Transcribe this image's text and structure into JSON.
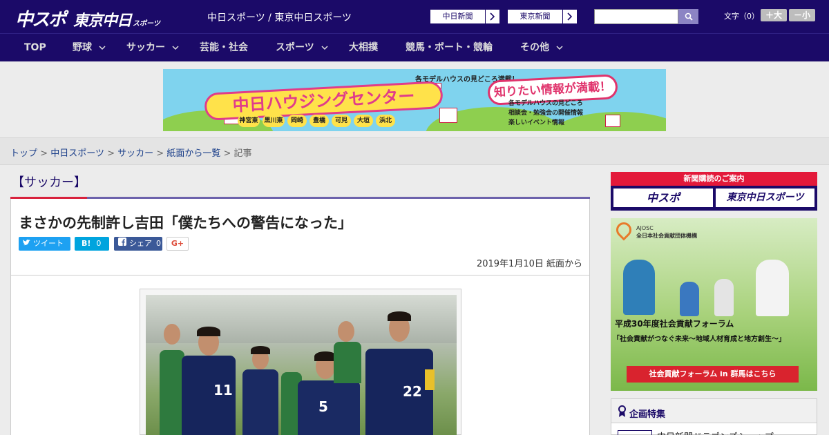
{
  "header": {
    "logo_main": "中スポ",
    "logo_tokyo": "東京中日",
    "logo_sports": "スポーツ",
    "site_description": "中日スポーツ / 東京中日スポーツ",
    "paper_links": [
      "中日新聞",
      "東京新聞"
    ],
    "search_placeholder": "",
    "font_size_label": "文字（0）",
    "font_larger": "＋大",
    "font_smaller": "－小"
  },
  "nav": {
    "items": [
      {
        "label": "TOP",
        "has_dropdown": false
      },
      {
        "label": "野球",
        "has_dropdown": true
      },
      {
        "label": "サッカー",
        "has_dropdown": true
      },
      {
        "label": "芸能・社会",
        "has_dropdown": false
      },
      {
        "label": "スポーツ",
        "has_dropdown": true
      },
      {
        "label": "大相撲",
        "has_dropdown": false
      },
      {
        "label": "競馬・ボート・競輪",
        "has_dropdown": false
      },
      {
        "label": "その他",
        "has_dropdown": true
      }
    ]
  },
  "banner": {
    "tagline": "各モデルハウスの見どころ満載！",
    "title": "中日ハウジングセンター",
    "bubble": "知りたい情報が満載！",
    "features": [
      "各モデルハウスの見どころ",
      "相談会・勉強会の開催情報",
      "楽しいイベント情報"
    ],
    "cities": [
      "神宮東",
      "黒川東",
      "岡崎",
      "豊橋",
      "可児",
      "大垣",
      "浜北"
    ]
  },
  "breadcrumb": {
    "links": [
      "トップ",
      "中日スポーツ",
      "サッカー",
      "紙面から一覧"
    ],
    "current": "記事",
    "separator": ">"
  },
  "article": {
    "category": "【サッカー】",
    "headline": "まさかの先制許し吉田「僕たちへの警告になった」",
    "share": {
      "tweet": "ツイート",
      "hatena_label": "B!",
      "hatena_count": "0",
      "fb_label": "シェア",
      "fb_count": "0",
      "gplus": "G+"
    },
    "date": "2019年1月10日 紙面から",
    "photo_numbers": [
      "11",
      "5",
      "22"
    ]
  },
  "sidebar": {
    "subscribe_title": "新聞購読のご案内",
    "subscribe_links": [
      "中スポ",
      "東京中日スポーツ"
    ],
    "ad": {
      "org_short": "AJOSC",
      "org_name": "全日本社会貢献団体機構",
      "title": "平成30年度社会貢献フォーラム",
      "subtitle": "「社会貢献がつなぐ未来～地域人材育成と地方創生～」",
      "cta": "社会貢献フォーラム in 群馬はこちら"
    },
    "feature_title": "企画特集",
    "feature_item": "中日新聞ドラゴンズショップ"
  },
  "colors": {
    "navy": "#1b0a68",
    "accent_red": "#d8223d",
    "link": "#1b3f8a",
    "twitter": "#1da1f2",
    "hatena": "#00a4de",
    "facebook": "#3b5998"
  }
}
